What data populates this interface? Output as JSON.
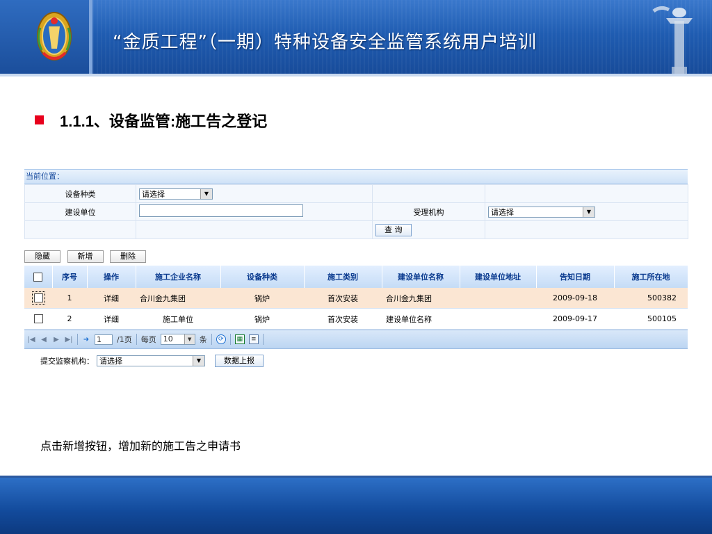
{
  "slide": {
    "title": "“金质工程”（一期）特种设备安全监管系统用户培训",
    "section_heading": "1.1.1、设备监管:施工告之登记",
    "note": "点击新增按钮，增加新的施工告之申请书"
  },
  "location_bar": {
    "label": "当前位置："
  },
  "filters": {
    "equipment_type_label": "设备种类",
    "equipment_type_value": "请选择",
    "builder_label": "建设单位",
    "builder_value": "",
    "agency_label": "受理机构",
    "agency_value": "请选择",
    "query_button": "查  询"
  },
  "actions": {
    "hide": "隐藏",
    "add": "新增",
    "delete": "删除"
  },
  "grid": {
    "columns": [
      "序号",
      "操作",
      "施工企业名称",
      "设备种类",
      "施工类别",
      "建设单位名称",
      "建设单位地址",
      "告知日期",
      "施工所在地"
    ],
    "rows": [
      {
        "seq": "1",
        "op": "详细",
        "company": "合川金九集团",
        "equip": "锅炉",
        "type": "首次安装",
        "builder": "合川金九集团",
        "addr": "",
        "date": "2009-09-18",
        "loc": "500382"
      },
      {
        "seq": "2",
        "op": "详细",
        "company": "施工单位",
        "equip": "锅炉",
        "type": "首次安装",
        "builder": "建设单位名称",
        "addr": "",
        "date": "2009-09-17",
        "loc": "500105"
      }
    ]
  },
  "pager": {
    "page_input": "1",
    "page_total": "/1页",
    "per_page_label": "每页",
    "per_page_value": "10",
    "per_page_unit": "条"
  },
  "submit": {
    "label": "提交监察机构：",
    "select_value": "请选择",
    "button": "数据上报"
  },
  "colors": {
    "header_blue": "#1f5cb1",
    "bullet_red": "#e8001c",
    "row_highlight": "#fbe6d3"
  }
}
